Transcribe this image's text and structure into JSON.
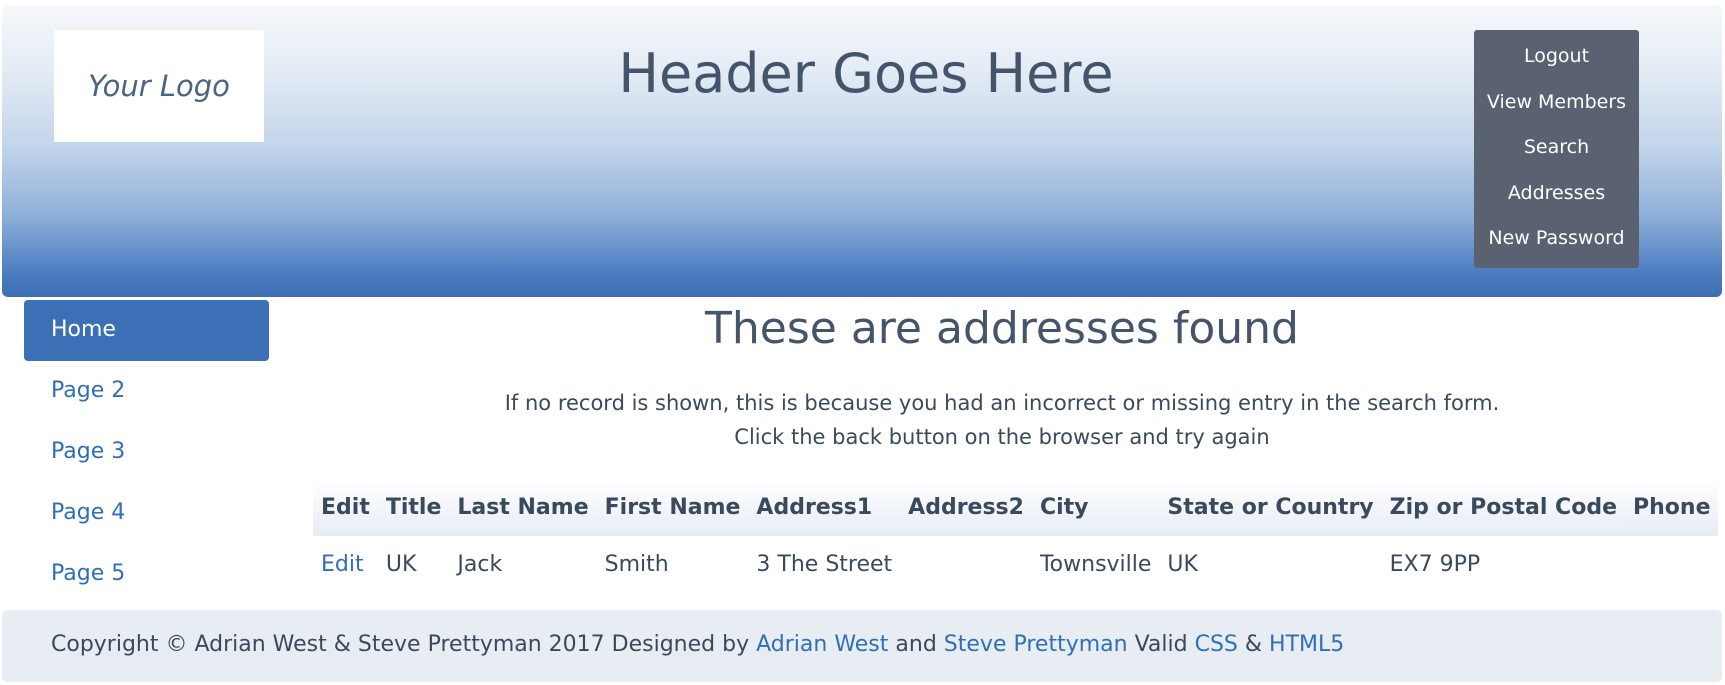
{
  "header": {
    "logo_text": "Your Logo",
    "title": "Header Goes Here",
    "menu": [
      {
        "label": "Logout"
      },
      {
        "label": "View Members"
      },
      {
        "label": "Search"
      },
      {
        "label": "Addresses"
      },
      {
        "label": "New Password"
      }
    ]
  },
  "sidebar": {
    "items": [
      {
        "label": "Home",
        "active": true
      },
      {
        "label": "Page 2",
        "active": false
      },
      {
        "label": "Page 3",
        "active": false
      },
      {
        "label": "Page 4",
        "active": false
      },
      {
        "label": "Page 5",
        "active": false
      }
    ]
  },
  "main": {
    "title": "These are addresses found",
    "notice_line1": "If no record is shown, this is because you had an incorrect or missing entry in the search form.",
    "notice_line2": "Click the back button on the browser and try again",
    "table": {
      "columns": [
        "Edit",
        "Title",
        "Last Name",
        "First Name",
        "Address1",
        "Address2",
        "City",
        "State or Country",
        "Zip or Postal Code",
        "Phone"
      ],
      "rows": [
        {
          "edit": "Edit",
          "title": "UK",
          "last_name": "Jack",
          "first_name": "Smith",
          "address1": "3 The Street",
          "address2": "",
          "city": "Townsville",
          "state": "UK",
          "zip": "EX7 9PP",
          "phone": ""
        }
      ]
    }
  },
  "footer": {
    "copyright": "Copyright © Adrian West & Steve Prettyman 2017 Designed by",
    "link1": "Adrian West",
    "and": "and",
    "link2": "Steve Prettyman",
    "valid": "Valid",
    "css": "CSS",
    "amp": "&",
    "html5": "HTML5"
  },
  "colors": {
    "accent": "#3b6fb6",
    "link": "#2f6fb7",
    "menu_bg": "#5a6170",
    "footer_bg": "#e8edf3",
    "text": "#3a4a5c"
  }
}
